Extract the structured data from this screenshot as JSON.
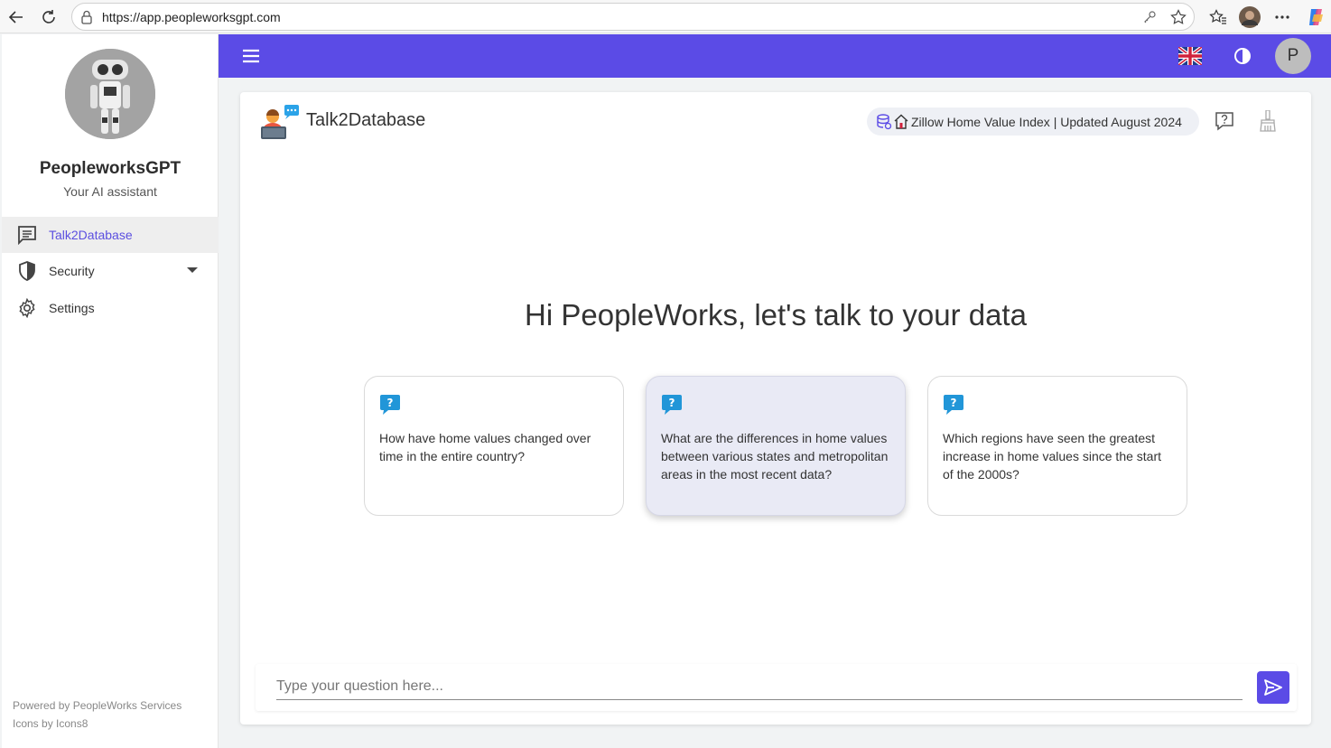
{
  "browser": {
    "url": "https://app.peopleworksgpt.com"
  },
  "sidebar": {
    "brand_name": "PeopleworksGPT",
    "tagline": "Your AI assistant",
    "items": [
      {
        "label": "Talk2Database"
      },
      {
        "label": "Security"
      },
      {
        "label": "Settings"
      }
    ],
    "footer_powered": "Powered by PeopleWorks Services",
    "footer_icons": "Icons by Icons8"
  },
  "appbar": {
    "user_initial": "P",
    "accent_color": "#5b4be6"
  },
  "main": {
    "title": "Talk2Database",
    "dataset": "Zillow Home Value Index | Updated August 2024",
    "greeting": "Hi PeopleWorks, let's talk to your data",
    "suggestions": [
      {
        "text": "How have home values changed over time in the entire country?"
      },
      {
        "text": "What are the differences in home values between various states and metropolitan areas in the most recent data?"
      },
      {
        "text": "Which regions have seen the greatest increase in home values since the start of the 2000s?"
      }
    ],
    "input_placeholder": "Type your question here..."
  }
}
